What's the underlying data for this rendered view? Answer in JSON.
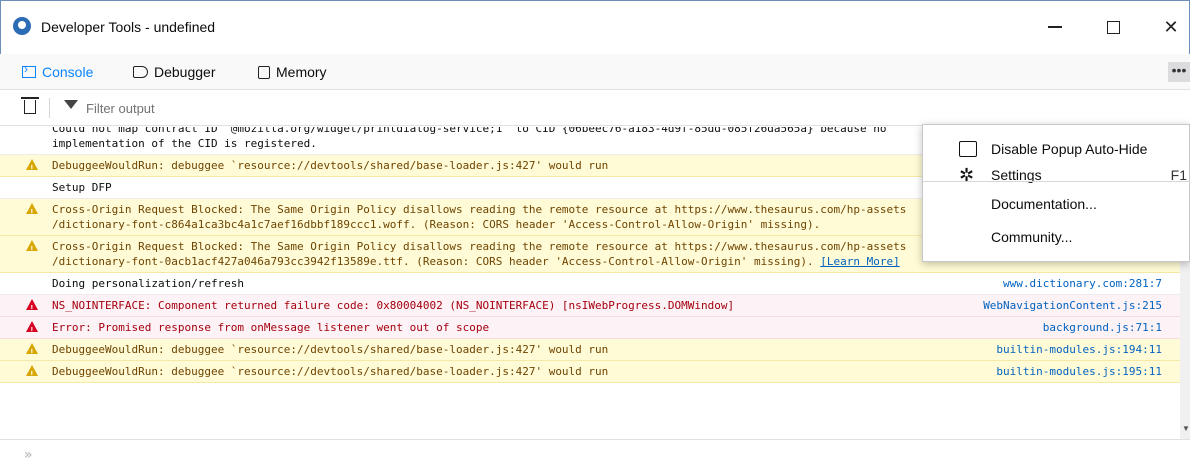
{
  "window": {
    "title": "Developer Tools - undefined"
  },
  "tabs": [
    {
      "label": "Console",
      "active": true
    },
    {
      "label": "Debugger",
      "active": false
    },
    {
      "label": "Memory",
      "active": false
    }
  ],
  "toolbar": {
    "filter_placeholder": "Filter output"
  },
  "popup": {
    "disable_label": "Disable Popup Auto-Hide",
    "settings_label": "Settings",
    "settings_key": "F1",
    "documentation_label": "Documentation...",
    "community_label": "Community..."
  },
  "log": [
    {
      "type": "plain",
      "msg": "Could not map contract ID \"@mozilla.org/widget/printdialog-service;1\" to CID {06beec76-a183-4d9f-85dd-085f26da565a} because no\nimplementation of the CID is registered.",
      "src": ""
    },
    {
      "type": "warn",
      "msg": "DebuggeeWouldRun: debuggee `resource://devtools/shared/base-loader.js:427' would run",
      "src": ""
    },
    {
      "type": "plain",
      "msg": "Setup DFP",
      "src": ""
    },
    {
      "type": "warn",
      "msg": "Cross-Origin Request Blocked: The Same Origin Policy disallows reading the remote resource at https://www.thesaurus.com/hp-assets\n/dictionary-font-c864a1ca3bc4a1c7aef16dbbf189ccc1.woff. (Reason: CORS header 'Access-Control-Allow-Origin' missing).",
      "src": ""
    },
    {
      "type": "warn",
      "msg": "Cross-Origin Request Blocked: The Same Origin Policy disallows reading the remote resource at https://www.thesaurus.com/hp-assets\n/dictionary-font-0acb1acf427a046a793cc3942f13589e.ttf. (Reason: CORS header 'Access-Control-Allow-Origin' missing). ",
      "link": "[Learn More]",
      "src": ""
    },
    {
      "type": "plain",
      "msg": "Doing personalization/refresh",
      "src": "www.dictionary.com:281:7"
    },
    {
      "type": "err",
      "msg": "NS_NOINTERFACE: Component returned failure code: 0x80004002 (NS_NOINTERFACE) [nsIWebProgress.DOMWindow]",
      "src": "WebNavigationContent.js:215"
    },
    {
      "type": "err",
      "msg": "Error: Promised response from onMessage listener went out of scope",
      "src": "background.js:71:1"
    },
    {
      "type": "warn",
      "msg": "DebuggeeWouldRun: debuggee `resource://devtools/shared/base-loader.js:427' would run",
      "src": "builtin-modules.js:194:11"
    },
    {
      "type": "warn",
      "msg": "DebuggeeWouldRun: debuggee `resource://devtools/shared/base-loader.js:427' would run",
      "src": "builtin-modules.js:195:11"
    }
  ],
  "colors": {
    "accent": "#0a84ff",
    "warning_bg": "#fffbd6",
    "error_bg": "#fdf2f5"
  }
}
